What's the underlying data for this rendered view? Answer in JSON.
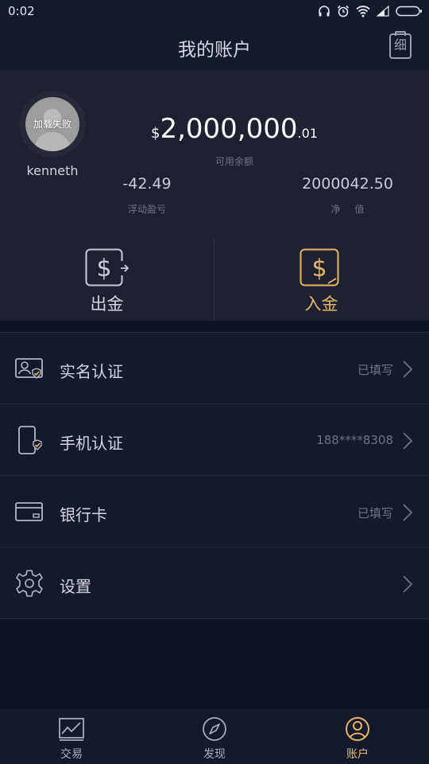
{
  "status_bar": {
    "time": "0:02"
  },
  "header": {
    "title": "我的账户",
    "detail_label": "细"
  },
  "account": {
    "avatar_text": "加载失败",
    "username": "kenneth",
    "balance_currency": "$",
    "balance_main": "2,000,000",
    "balance_cents": ".01",
    "balance_label": "可用余额",
    "floating_pnl_value": "-42.49",
    "floating_pnl_label": "浮动盈亏",
    "equity_value": "2000042.50",
    "equity_label": "净值"
  },
  "actions": {
    "withdraw_label": "出金",
    "deposit_label": "入金"
  },
  "menu": [
    {
      "label": "实名认证",
      "value": "已填写",
      "icon": "id-card-icon"
    },
    {
      "label": "手机认证",
      "value": "188****8308",
      "icon": "phone-verified-icon"
    },
    {
      "label": "银行卡",
      "value": "已填写",
      "icon": "bank-card-icon"
    },
    {
      "label": "设置",
      "value": "",
      "icon": "gear-icon"
    }
  ],
  "tabs": [
    {
      "label": "交易",
      "icon": "chart-icon",
      "active": false
    },
    {
      "label": "发现",
      "icon": "compass-icon",
      "active": false
    },
    {
      "label": "账户",
      "icon": "user-icon",
      "active": true
    }
  ],
  "colors": {
    "accent": "#e8b565",
    "background": "#0d1226",
    "panel": "#1e2230",
    "bar": "#141a2b"
  }
}
